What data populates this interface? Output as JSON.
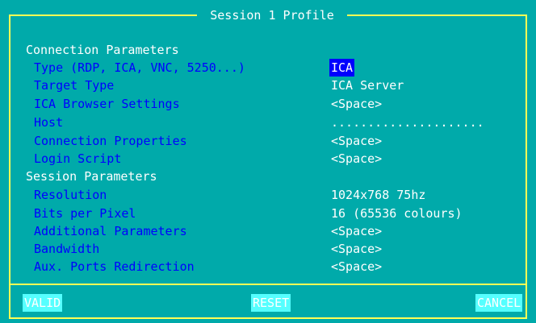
{
  "window": {
    "title": "Session 1 Profile"
  },
  "sections": {
    "connection": "Connection Parameters",
    "session": "Session Parameters"
  },
  "fields": {
    "type": {
      "label": "Type (RDP, ICA, VNC, 5250...)",
      "value": "ICA"
    },
    "target_type": {
      "label": "Target Type",
      "value": "ICA Server"
    },
    "ica_browser": {
      "label": "ICA Browser Settings",
      "value": "<Space>"
    },
    "host": {
      "label": "Host",
      "value": "....................."
    },
    "connection_properties": {
      "label": "Connection Properties",
      "value": "<Space>"
    },
    "login_script": {
      "label": "Login Script",
      "value": "<Space>"
    },
    "resolution": {
      "label": "Resolution",
      "value": "1024x768 75hz"
    },
    "bits_per_pixel": {
      "label": "Bits per Pixel",
      "value": "16 (65536 colours)"
    },
    "additional_parameters": {
      "label": "Additional Parameters",
      "value": "<Space>"
    },
    "bandwidth": {
      "label": "Bandwidth",
      "value": "<Space>"
    },
    "aux_ports": {
      "label": "Aux. Ports Redirection",
      "value": "<Space>"
    }
  },
  "buttons": {
    "valid": "VALID",
    "reset": "RESET",
    "cancel": "CANCEL"
  },
  "colors": {
    "background": "#00aaaa",
    "border": "#ffff55",
    "label": "#0000ff",
    "text": "#ffffff",
    "selection": "#0000ff",
    "button": "#55ffff"
  }
}
